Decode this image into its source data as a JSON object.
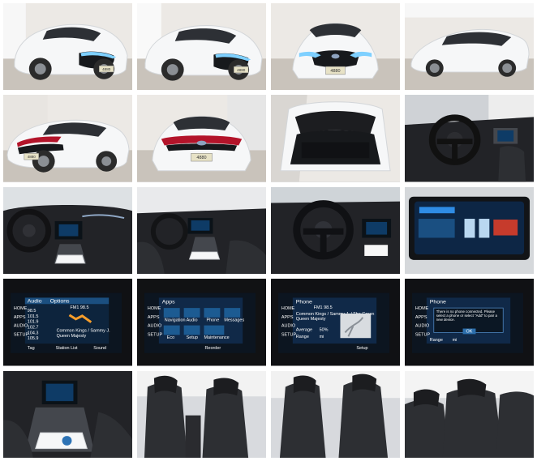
{
  "gallery": {
    "tiles": [
      {
        "icon": "front-three-quarter-icon"
      },
      {
        "icon": "front-three-quarter-icon"
      },
      {
        "icon": "front-view-icon"
      },
      {
        "icon": "side-profile-icon"
      },
      {
        "icon": "rear-three-quarter-icon"
      },
      {
        "icon": "rear-view-icon"
      },
      {
        "icon": "cargo-area-icon"
      },
      {
        "icon": "steering-wheel-icon"
      },
      {
        "icon": "dashboard-icon"
      },
      {
        "icon": "interior-icon"
      },
      {
        "icon": "steering-wheel-icon"
      },
      {
        "icon": "instrument-cluster-icon"
      },
      {
        "icon": "audio-screen-icon"
      },
      {
        "icon": "apps-screen-icon"
      },
      {
        "icon": "phone-screen-icon"
      },
      {
        "icon": "phone-connect-screen-icon"
      },
      {
        "icon": "center-console-icon"
      },
      {
        "icon": "front-seats-icon"
      },
      {
        "icon": "seats-icon"
      },
      {
        "icon": "rear-seats-icon"
      }
    ]
  },
  "vehicle_text": {
    "plate": "4880"
  },
  "screens": {
    "audio": {
      "tab_audio": "Audio",
      "tab_options": "Options",
      "freq": "FM1 98.5",
      "sidebar": [
        "HOME",
        "APPS",
        "AUDIO",
        "SETUP"
      ],
      "stations": [
        "98.5",
        "101.5",
        "101.9",
        "102.7",
        "104.3",
        "105.9"
      ],
      "artist_1": "Common Kings / Sammy J.",
      "artist_2": "Queen Majesty",
      "bottom_1": "Tag",
      "bottom_2": "Station List",
      "bottom_3": "Sound"
    },
    "apps": {
      "title": "Apps",
      "sidebar": [
        "HOME",
        "APPS",
        "AUDIO",
        "SETUP"
      ],
      "items": [
        "Navigation",
        "Audio",
        "Phone",
        "Messages",
        "Eco",
        "Setup",
        "Maintenance"
      ],
      "reorder": "Reorder"
    },
    "phone": {
      "title": "Phone",
      "freq": "FM1 98.5",
      "sidebar": [
        "HOME",
        "APPS",
        "AUDIO",
        "SETUP"
      ],
      "line1": "Common Kings / Sammy J. / The Green",
      "line2": "Queen Majesty",
      "volume_label": "Average",
      "volume_value": "50%",
      "range_label": "Range",
      "range_value": "mi",
      "setup": "Setup"
    },
    "phone_connect": {
      "title": "Phone",
      "sidebar": [
        "HOME",
        "APPS",
        "AUDIO",
        "SETUP"
      ],
      "message": "There is no phone connected. Please select a phone or select \"Add\" to pair a new device.",
      "ok": "OK",
      "range_label": "Range",
      "range_value": "mi"
    }
  }
}
